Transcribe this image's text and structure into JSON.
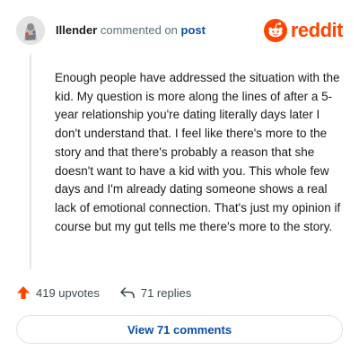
{
  "comment": {
    "username": "Illender",
    "action_text": "commented on",
    "target": "post",
    "body": "Enough people have addressed the situation with the kid. My question is more along the lines of after a 5-year relationship you're dating literally days later I don't understand that. I feel like there's more to the story and that there's probably a reason that she doesn't want to have a kid with you. This whole few days and I'm already dating someone shows a real lack of emotional connection. That's just my opinion if course but my gut tells me there's more to the story.",
    "upvotes": "419 upvotes",
    "replies": "71 replies"
  },
  "brand": {
    "name": "reddit",
    "color": "#ff4500"
  },
  "view_button": {
    "label": "View 71 comments"
  },
  "icons": [
    "user-avatar",
    "reddit-logo-icon",
    "upvote-arrow-icon",
    "reply-arrow-icon"
  ],
  "colors": {
    "accent": "#ff4500",
    "link": "#0a4fa3",
    "muted": "#576f76",
    "border": "#dfe3e6"
  }
}
